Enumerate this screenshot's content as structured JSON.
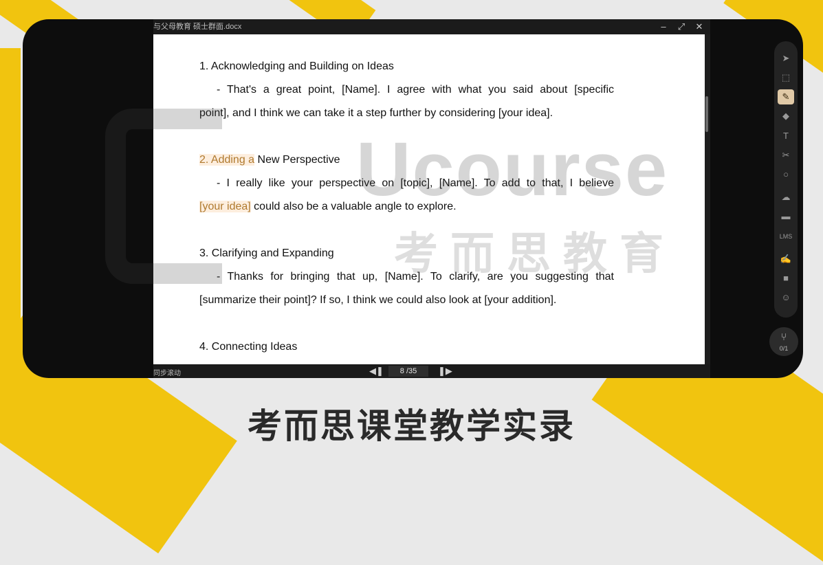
{
  "window": {
    "title": "与父母教育 硕士群面.docx",
    "minimize_icon": "minimize-icon",
    "maximize_icon": "maximize-icon",
    "close_icon": "close-icon"
  },
  "document": {
    "s1_heading": "1. Acknowledging and Building on Ideas",
    "s1_line1": "- That's a great point, [Name]. I agree with what you said about [specific",
    "s1_line2": "point], and I think we can take it a step further by considering [your idea].",
    "s2_heading_hl": "2. Adding a",
    "s2_heading_rest": " New Perspective",
    "s2_line1": "- I really like your perspective on [topic], [Name]. To add to that, I believe",
    "s2_line2_hl": "[your idea]",
    "s2_line2_rest": " could also be a valuable angle to explore.",
    "s3_heading": "3. Clarifying and Expanding",
    "s3_line1": "- Thanks for bringing that up, [Name]. To clarify, are you suggesting that",
    "s3_line2": "[summarize their point]? If so, I think we could also look at [your addition].",
    "s4_heading": "4. Connecting Ideas"
  },
  "footer": {
    "sync_label": "同步滚动",
    "page_indicator": "8 /35",
    "prev_icon": "prev-page-icon",
    "next_icon": "next-page-icon"
  },
  "toolbar": {
    "tools": [
      {
        "name": "pointer-icon",
        "glyph": "➤"
      },
      {
        "name": "select-area-icon",
        "glyph": "⬚"
      },
      {
        "name": "pen-icon",
        "glyph": "✎"
      },
      {
        "name": "eraser-icon",
        "glyph": "◆"
      },
      {
        "name": "text-icon",
        "glyph": "T"
      },
      {
        "name": "scissors-icon",
        "glyph": "✂"
      },
      {
        "name": "shape-icon",
        "glyph": "○"
      },
      {
        "name": "cloud-icon",
        "glyph": "☁"
      },
      {
        "name": "toolbox-icon",
        "glyph": "▬"
      },
      {
        "name": "lms-label",
        "glyph": "LMS"
      },
      {
        "name": "edit-icon",
        "glyph": "✍"
      },
      {
        "name": "chat-icon",
        "glyph": "■"
      },
      {
        "name": "users-icon",
        "glyph": "☺"
      }
    ],
    "active_tool": "pen-icon"
  },
  "seat": {
    "count": "0/1",
    "icon": "seat-icon",
    "glyph": "⑂"
  },
  "watermark": {
    "brand": "Ucourse",
    "cn": "考而思教育"
  },
  "caption": "考而思课堂教学实录",
  "colors": {
    "accent_yellow": "#f1c40f",
    "highlight_bg": "#fdeede",
    "highlight_text": "#b07a2f"
  }
}
